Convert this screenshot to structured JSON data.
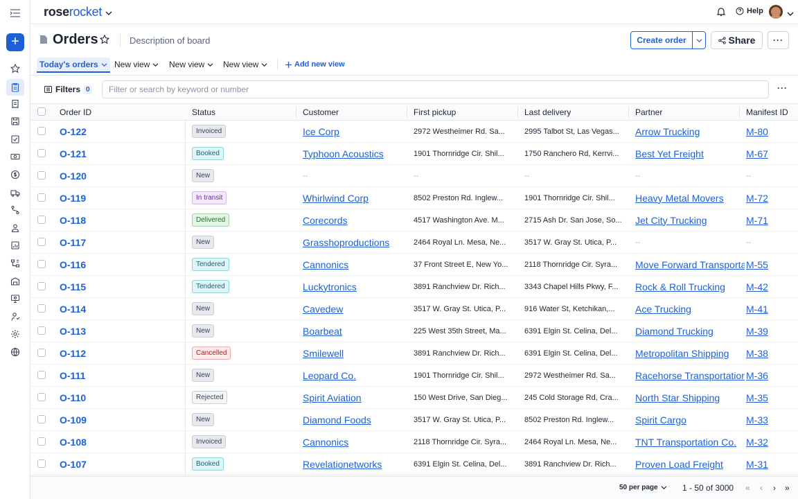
{
  "app": {
    "brand_part1": "rose",
    "brand_part2": "rocket",
    "help_label": "Help",
    "accent": "#1f5fd6"
  },
  "rail": {
    "icons": [
      "menu-icon",
      "plus-icon",
      "star-icon",
      "clipboard-icon",
      "receipt-icon",
      "save-icon",
      "checklist-icon",
      "money-icon",
      "dollar-icon",
      "truck-icon",
      "route-icon",
      "people-icon",
      "chart-icon",
      "org-icon",
      "warehouse-icon",
      "monitor-icon",
      "contact-icon",
      "gear-icon",
      "globe-icon"
    ]
  },
  "header": {
    "title": "Orders",
    "description": "Description of board",
    "create_label": "Create order",
    "share_label": "Share",
    "more_label": "···"
  },
  "views": {
    "items": [
      {
        "label": "Today's orders",
        "active": true
      },
      {
        "label": "New view",
        "active": false
      },
      {
        "label": "New view",
        "active": false
      },
      {
        "label": "New view",
        "active": false
      }
    ],
    "add_label": "Add new view"
  },
  "filters": {
    "label": "Filters",
    "count": "0",
    "search_placeholder": "Filter or search by keyword or number",
    "more_label": "···"
  },
  "table": {
    "columns": [
      "Order ID",
      "Status",
      "Customer",
      "First pickup",
      "Last delivery",
      "Partner",
      "Manifest ID"
    ],
    "rows": [
      {
        "id": "O-122",
        "status": "Invoiced",
        "customer": "Ice Corp",
        "pickup": "2972 Westheimer Rd. Sa...",
        "delivery": "2995 Talbot St, Las Vegas...",
        "partner": "Arrow Trucking",
        "manifest": "M-80"
      },
      {
        "id": "O-121",
        "status": "Booked",
        "customer": "Typhoon Acoustics",
        "pickup": "1901 Thornridge Cir. Shil...",
        "delivery": "1750 Ranchero Rd, Kerrvi...",
        "partner": "Best Yet Freight",
        "manifest": "M-67"
      },
      {
        "id": "O-120",
        "status": "New",
        "customer": "--",
        "pickup": "--",
        "delivery": "--",
        "partner": "--",
        "manifest": "--"
      },
      {
        "id": "O-119",
        "status": "In transit",
        "customer": "Whirlwind Corp",
        "pickup": "8502 Preston Rd. Inglew...",
        "delivery": "1901 Thornridge Cir. Shil...",
        "partner": "Heavy Metal Movers",
        "manifest": "M-72"
      },
      {
        "id": "O-118",
        "status": "Delivered",
        "customer": "Corecords",
        "pickup": "4517 Washington Ave. M...",
        "delivery": "2715 Ash Dr. San Jose, So...",
        "partner": "Jet City Trucking",
        "manifest": "M-71"
      },
      {
        "id": "O-117",
        "status": "New",
        "customer": "Grasshoproductions",
        "pickup": "2464 Royal Ln. Mesa, Ne...",
        "delivery": "3517 W. Gray St. Utica, P...",
        "partner": "--",
        "manifest": "--"
      },
      {
        "id": "O-116",
        "status": "Tendered",
        "customer": "Cannonics",
        "pickup": "37 Front Street E, New Yo...",
        "delivery": "2118 Thornridge Cir. Syra...",
        "partner": "Move Forward Transportation",
        "manifest": "M-55"
      },
      {
        "id": "O-115",
        "status": "Tendered",
        "customer": "Luckytronics",
        "pickup": "3891 Ranchview Dr. Rich...",
        "delivery": "3343 Chapel Hills Pkwy, F...",
        "partner": "Rock & Roll Trucking",
        "manifest": "M-42"
      },
      {
        "id": "O-114",
        "status": "New",
        "customer": "Cavedew",
        "pickup": "3517 W. Gray St. Utica, P...",
        "delivery": "916 Water St, Ketchikan,...",
        "partner": "Ace Trucking",
        "manifest": "M-41"
      },
      {
        "id": "O-113",
        "status": "New",
        "customer": "Boarbeat",
        "pickup": "225 West 35th Street, Ma...",
        "delivery": "6391 Elgin St. Celina, Del...",
        "partner": "Diamond Trucking",
        "manifest": "M-39"
      },
      {
        "id": "O-112",
        "status": "Cancelled",
        "customer": "Smilewell",
        "pickup": "3891 Ranchview Dr. Rich...",
        "delivery": "6391 Elgin St. Celina, Del...",
        "partner": "Metropolitan Shipping",
        "manifest": "M-38"
      },
      {
        "id": "O-111",
        "status": "New",
        "customer": "Leopard Co.",
        "pickup": "1901 Thornridge Cir. Shil...",
        "delivery": "2972 Westheimer Rd. Sa...",
        "partner": "Racehorse Transportation",
        "manifest": "M-36"
      },
      {
        "id": "O-110",
        "status": "Rejected",
        "customer": "Spirit Aviation",
        "pickup": "150 West Drive, San Dieg...",
        "delivery": "245 Cold Storage Rd, Cra...",
        "partner": "North Star Shipping",
        "manifest": "M-35"
      },
      {
        "id": "O-109",
        "status": "New",
        "customer": "Diamond Foods",
        "pickup": "3517 W. Gray St. Utica, P...",
        "delivery": "8502 Preston Rd. Inglew...",
        "partner": "Spirit Cargo",
        "manifest": "M-33"
      },
      {
        "id": "O-108",
        "status": "Invoiced",
        "customer": "Cannonics",
        "pickup": "2118 Thornridge Cir. Syra...",
        "delivery": "2464 Royal Ln. Mesa, Ne...",
        "partner": "TNT Transportation Co.",
        "manifest": "M-32"
      },
      {
        "id": "O-107",
        "status": "Booked",
        "customer": "Revelationetworks",
        "pickup": "6391 Elgin St. Celina, Del...",
        "delivery": "3891 Ranchview Dr. Rich...",
        "partner": "Proven Load Freight",
        "manifest": "M-31"
      }
    ]
  },
  "status_colors": {
    "Invoiced": {
      "bg": "#e6e9ee",
      "fg": "#3b4455",
      "border": "#c9ced8"
    },
    "Booked": {
      "bg": "#dff5f7",
      "fg": "#176b73",
      "border": "#8fd4db"
    },
    "New": {
      "bg": "#e6e9ee",
      "fg": "#3b4455",
      "border": "#c9ced8"
    },
    "In transit": {
      "bg": "#f3e9fb",
      "fg": "#6a2fa0",
      "border": "#d2b5ea"
    },
    "Delivered": {
      "bg": "#e3f5e4",
      "fg": "#23702d",
      "border": "#9fd6a6"
    },
    "Tendered": {
      "bg": "#dff5f7",
      "fg": "#176b73",
      "border": "#8fd4db"
    },
    "Cancelled": {
      "bg": "#fdecec",
      "fg": "#a52121",
      "border": "#efa9a9"
    },
    "Rejected": {
      "bg": "#f4f5f7",
      "fg": "#3b4455",
      "border": "#c9ced8"
    }
  },
  "footer": {
    "per_page": "50 per page",
    "range": "1 - 50 of 3000"
  }
}
